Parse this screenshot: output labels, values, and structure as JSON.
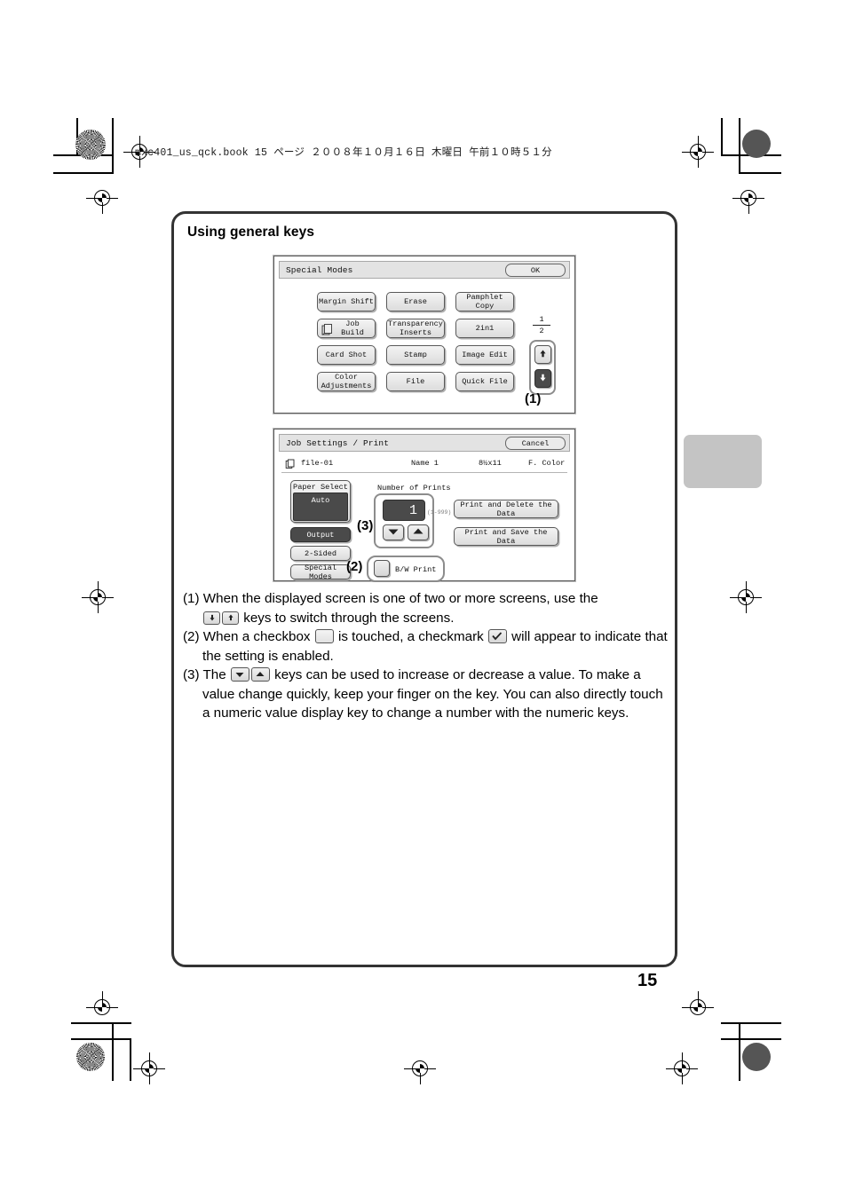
{
  "page": {
    "book_header": "mxc401_us_qck.book   15 ページ   ２００８年１０月１６日   木曜日   午前１０時５１分",
    "page_number": "15",
    "section_title": "Using general keys"
  },
  "special_modes_panel": {
    "title": "Special Modes",
    "ok_label": "OK",
    "keys": [
      "Margin Shift",
      "Erase",
      "Pamphlet Copy",
      "Job Build",
      "Transparency Inserts",
      "2in1",
      "Card Shot",
      "Stamp",
      "Image Edit",
      "Color Adjustments",
      "File",
      "Quick File"
    ],
    "key_rows": [
      [
        {
          "label": "Margin Shift",
          "icon": null
        },
        {
          "label": "Erase",
          "icon": null
        },
        {
          "label": "Pamphlet Copy",
          "icon": null
        }
      ],
      [
        {
          "label": "Job\nBuild",
          "icon": "job-build-icon"
        },
        {
          "label": "Transparency\nInserts",
          "icon": null
        },
        {
          "label": "2in1",
          "icon": null
        }
      ],
      [
        {
          "label": "Card Shot",
          "icon": null
        },
        {
          "label": "Stamp",
          "icon": null
        },
        {
          "label": "Image Edit",
          "icon": null
        }
      ],
      [
        {
          "label": "Color\nAdjustments",
          "icon": null
        },
        {
          "label": "File",
          "icon": null
        },
        {
          "label": "Quick File",
          "icon": null
        }
      ]
    ],
    "page_indicator": {
      "current": "1",
      "total": "2"
    },
    "nav": {
      "up_icon": "arrow-up-icon",
      "down_icon": "arrow-down-icon"
    },
    "callout": "(1)"
  },
  "job_settings_panel": {
    "title": "Job Settings / Print",
    "cancel_label": "Cancel",
    "info_row": {
      "file_icon": "document-file-icon",
      "file_name": "file-01",
      "user_name": "Name 1",
      "paper_size": "8½x11",
      "color_mode": "F. Color"
    },
    "left_keys": {
      "paper_select_label": "Paper Select",
      "paper_select_value": "Auto",
      "output_label": "Output",
      "two_sided_label": "2-Sided",
      "special_modes_label": "Special Modes"
    },
    "number_of_prints": {
      "label": "Number of Prints",
      "value": "1",
      "range_note": "(1-999)",
      "down_icon": "triangle-down-icon",
      "up_icon": "triangle-up-icon"
    },
    "bw_print": {
      "checkbox_label": "B/W Print",
      "checked": false
    },
    "right_keys": [
      "Print and Delete the Data",
      "Print and Save the Data"
    ],
    "callout_numprints": "(3)",
    "callout_checkbox": "(2)"
  },
  "instructions": [
    {
      "num": "(1)",
      "parts": [
        {
          "type": "text",
          "value": "When the displayed screen is one of two or more screens, use the "
        },
        {
          "type": "key",
          "icon": "arrow-down-icon"
        },
        {
          "type": "key",
          "icon": "arrow-up-icon"
        },
        {
          "type": "text",
          "value": " keys to switch through the screens."
        }
      ],
      "plain": "When the displayed screen is one of two or more screens, use the [down][up] keys to switch through the screens."
    },
    {
      "num": "(2)",
      "parts": [
        {
          "type": "text",
          "value": "When a checkbox "
        },
        {
          "type": "key",
          "icon": "empty-checkbox-icon"
        },
        {
          "type": "text",
          "value": " is touched, a checkmark "
        },
        {
          "type": "key",
          "icon": "checkmark-icon"
        },
        {
          "type": "text",
          "value": " will appear to indicate that the setting is enabled."
        }
      ],
      "plain": "When a checkbox [ ] is touched, a checkmark [✓] will appear to indicate that the setting is enabled."
    },
    {
      "num": "(3)",
      "parts": [
        {
          "type": "text",
          "value": "The "
        },
        {
          "type": "key",
          "icon": "triangle-down-icon"
        },
        {
          "type": "key",
          "icon": "triangle-up-icon"
        },
        {
          "type": "text",
          "value": " keys can be used to increase or decrease a value. To make a value change quickly, keep your finger on the key. You can also directly touch a numeric value display key to change a number with the numeric keys."
        }
      ],
      "plain": "The [▼][▲] keys can be used to increase or decrease a value. To make a value change quickly, keep your finger on the key. You can also directly touch a numeric value display key to change a number with the numeric keys."
    }
  ],
  "colors": {
    "frame_border": "#333333",
    "lcd_key_dark": "#4a4a4a",
    "chapter_tab": "#c4c4c4"
  }
}
